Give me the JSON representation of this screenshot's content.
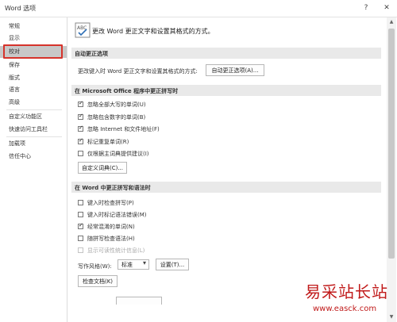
{
  "window": {
    "title": "Word 选项",
    "help": "?",
    "close": "✕"
  },
  "sidebar": {
    "items": [
      {
        "label": "常规"
      },
      {
        "label": "显示"
      },
      {
        "label": "校对",
        "active": true
      },
      {
        "label": "保存"
      },
      {
        "label": "版式"
      },
      {
        "label": "语言"
      },
      {
        "label": "高级"
      },
      {
        "label": "自定义功能区"
      },
      {
        "label": "快速访问工具栏"
      },
      {
        "label": "加载项"
      },
      {
        "label": "信任中心"
      }
    ]
  },
  "main": {
    "header": {
      "icon": "abc-proofing-icon",
      "text": "更改 Word 更正文字和设置其格式的方式。"
    },
    "autocorrect": {
      "title": "自动更正选项",
      "desc": "更改键入时 Word 更正文字和设置其格式的方式:",
      "button": "自动更正选项(A)..."
    },
    "office_spelling": {
      "title": "在 Microsoft Office 程序中更正拼写时",
      "options": [
        {
          "label": "忽略全部大写的单词(U)",
          "checked": true
        },
        {
          "label": "忽略包含数字的单词(B)",
          "checked": true
        },
        {
          "label": "忽略 Internet 和文件地址(F)",
          "checked": true
        },
        {
          "label": "标记重复单词(R)",
          "checked": true
        },
        {
          "label": "仅根据主词典提供建议(I)",
          "checked": false
        }
      ],
      "button": "自定义词典(C)..."
    },
    "word_spelling": {
      "title": "在 Word 中更正拼写和语法时",
      "options": [
        {
          "label": "键入时检查拼写(P)",
          "checked": false
        },
        {
          "label": "键入时标记语法错误(M)",
          "checked": false
        },
        {
          "label": "经常混淆的单词(N)",
          "checked": true
        },
        {
          "label": "随拼写检查语法(H)",
          "checked": false
        },
        {
          "label": "显示可读性统计信息(L)",
          "checked": false,
          "disabled": true
        }
      ],
      "style_label": "写作风格(W):",
      "style_value": "标准",
      "settings_button": "设置(T)...",
      "check_button": "检查文档(K)"
    }
  },
  "watermark": {
    "title": "易采站长站",
    "url": "www.easck.com",
    "color": "#c01a1a"
  }
}
